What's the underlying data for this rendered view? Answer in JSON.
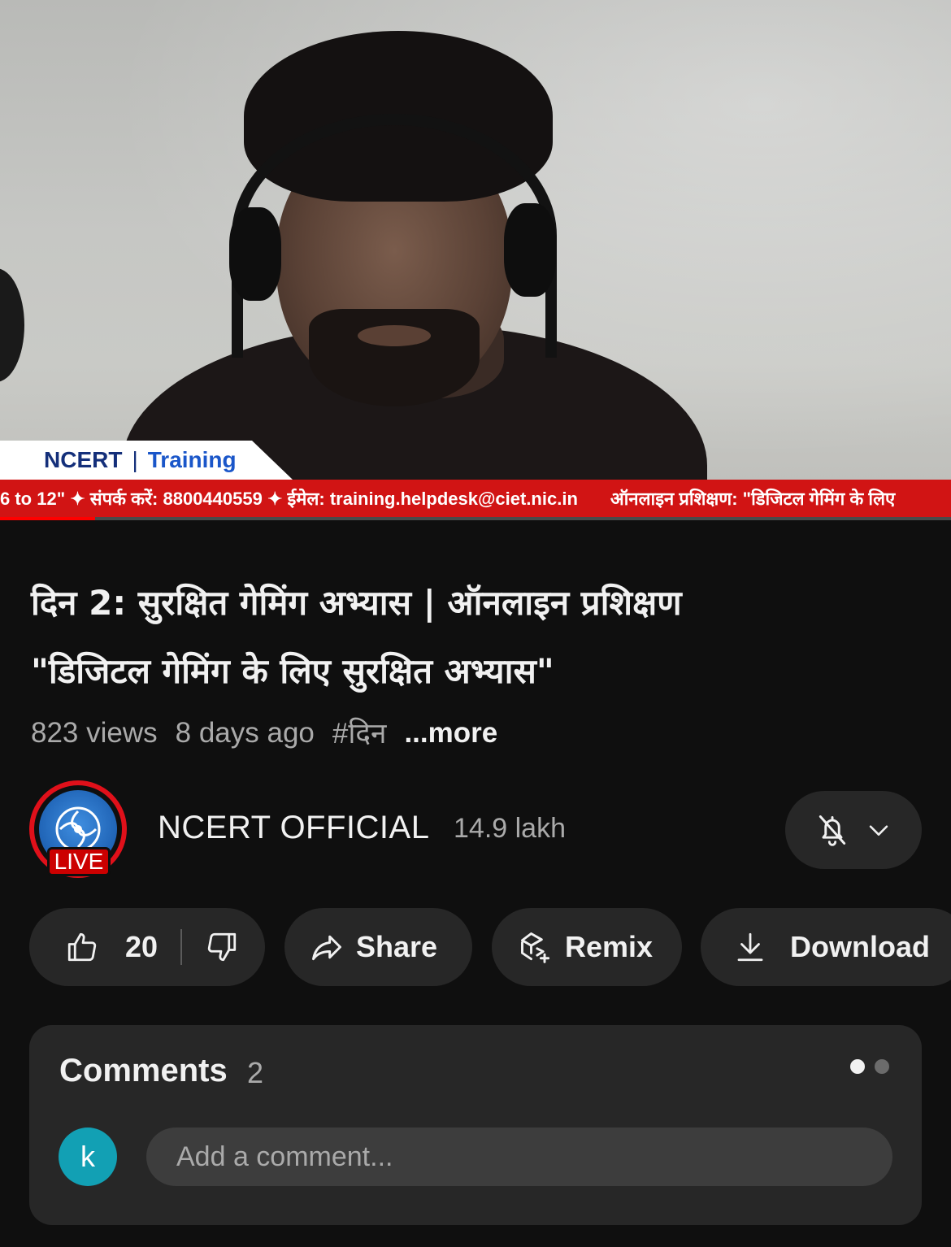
{
  "video": {
    "banner_left": "NCERT",
    "banner_right": "Training",
    "ticker_part1": "6 to 12\" ✦ संपर्क करें: 8800440559 ✦ ईमेल: training.helpdesk@ciet.nic.in",
    "ticker_part2": "ऑनलाइन प्रशिक्षण: \"डिजिटल गेमिंग के लिए",
    "progress_fraction": 0.1
  },
  "title": {
    "line1": "दिन 2:  सुरक्षित गेमिंग अभ्यास | ऑनलाइन प्रशिक्षण",
    "line2": "\"डिजिटल गेमिंग के लिए सुरक्षित अभ्यास\""
  },
  "meta": {
    "views": "823 views",
    "age": "8 days ago",
    "hashtag": "#दिन",
    "more": "...more"
  },
  "channel": {
    "name": "NCERT OFFICIAL",
    "subscribers": "14.9 lakh",
    "live_badge": "LIVE",
    "notification_icon": "bell-off-icon"
  },
  "actions": {
    "likes": "20",
    "share": "Share",
    "remix": "Remix",
    "download": "Download"
  },
  "comments": {
    "title": "Comments",
    "count": "2",
    "user_initial": "k",
    "placeholder": "Add a comment..."
  },
  "colors": {
    "background": "#0f0f0f",
    "surface": "#272727",
    "live_red": "#cc0000",
    "ticker_red": "#d11414",
    "user_avatar": "#12a0b4"
  }
}
